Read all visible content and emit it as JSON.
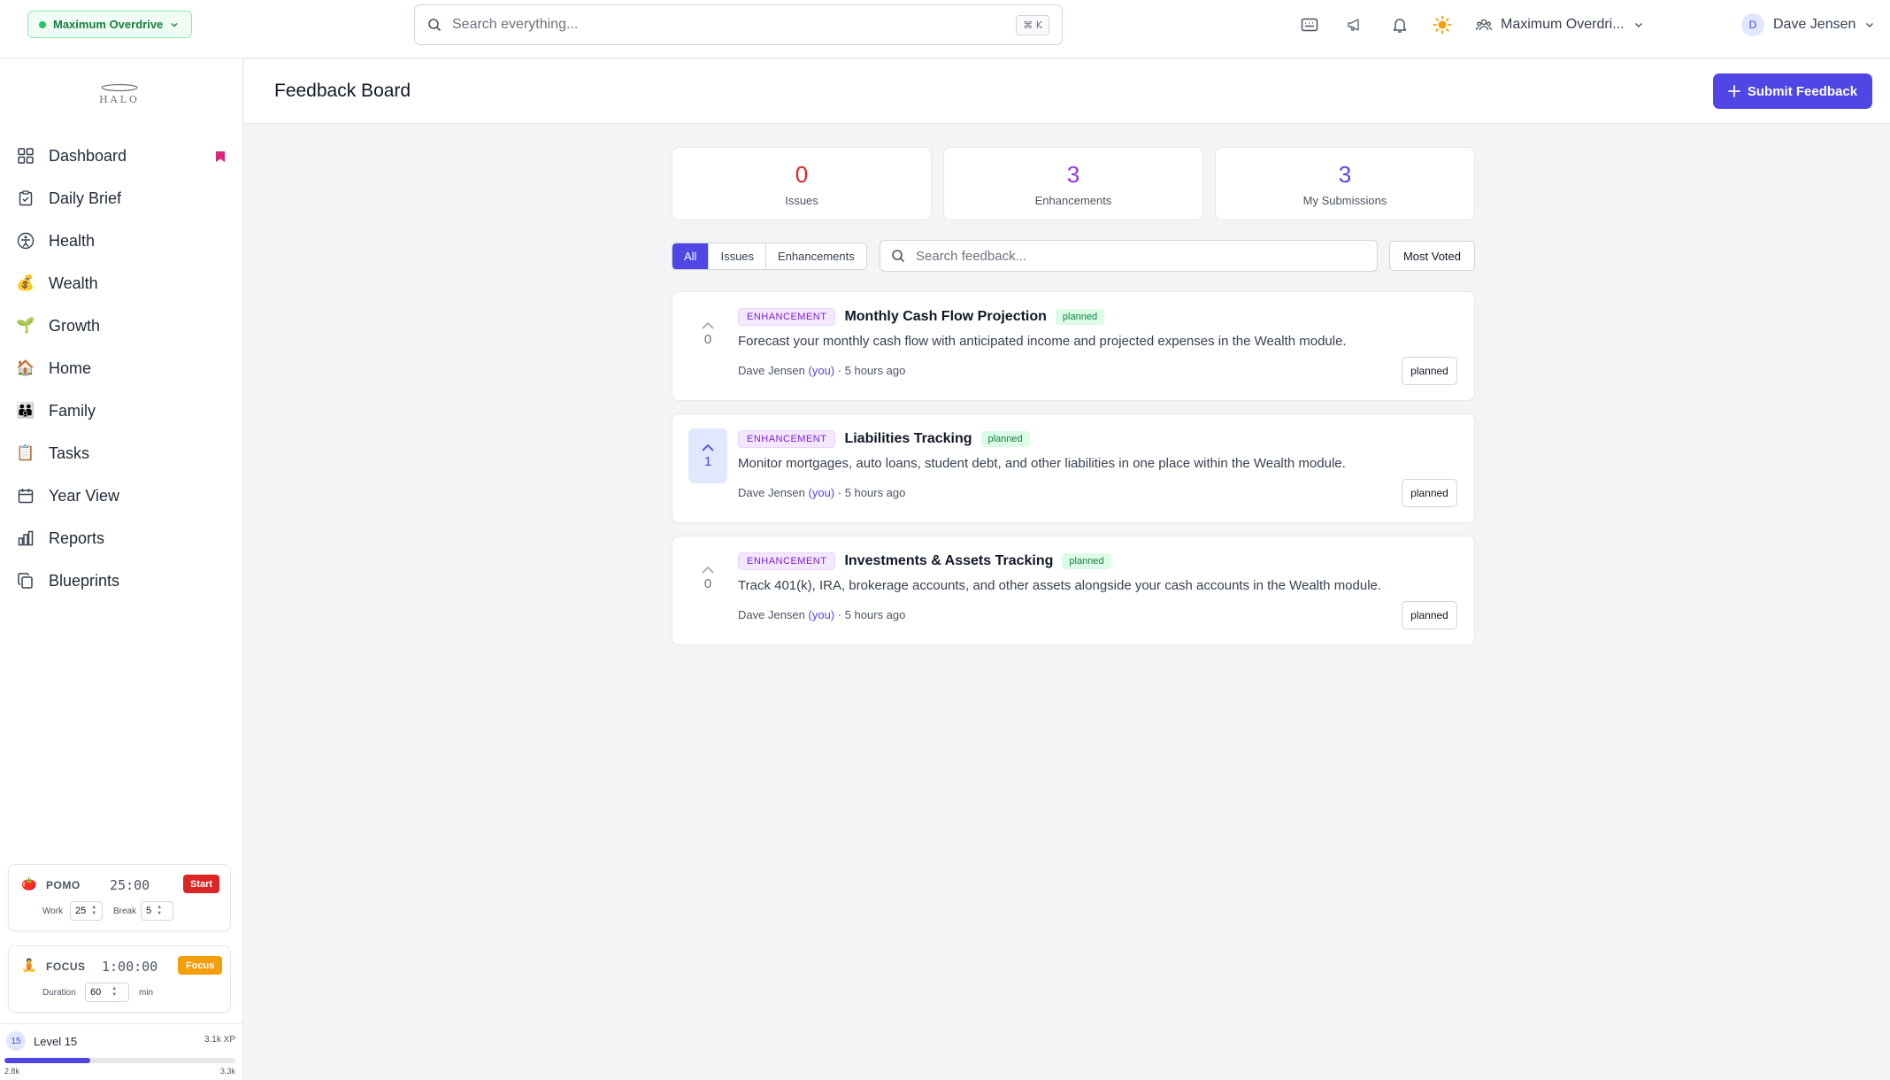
{
  "topbar": {
    "mode_label": "Maximum Overdrive",
    "search_placeholder": "Search everything...",
    "search_shortcut": "⌘ K",
    "workspace_label": "Maximum Overdri...",
    "user_initial": "D",
    "user_name": "Dave Jensen"
  },
  "sidebar": {
    "logo_text": "HALO",
    "items": [
      {
        "label": "Dashboard",
        "icon": "grid-icon"
      },
      {
        "label": "Daily Brief",
        "icon": "clipboard-check-icon"
      },
      {
        "label": "Health",
        "icon": "wellness-icon"
      },
      {
        "label": "Wealth",
        "icon": "money-bag-icon"
      },
      {
        "label": "Growth",
        "icon": "seedling-icon"
      },
      {
        "label": "Home",
        "icon": "house-icon"
      },
      {
        "label": "Family",
        "icon": "family-icon"
      },
      {
        "label": "Tasks",
        "icon": "notepad-icon"
      },
      {
        "label": "Year View",
        "icon": "calendar-icon"
      },
      {
        "label": "Reports",
        "icon": "bar-chart-icon"
      },
      {
        "label": "Blueprints",
        "icon": "copy-icon"
      }
    ],
    "pomo": {
      "title": "POMO",
      "timer": "25:00",
      "start_label": "Start",
      "work_label": "Work",
      "work_value": "25",
      "break_label": "Break",
      "break_value": "5"
    },
    "focus": {
      "title": "FOCUS",
      "timer": "1:00:00",
      "focus_label": "Focus",
      "duration_label": "Duration",
      "duration_value": "60",
      "unit": "min"
    },
    "level": {
      "badge": "15",
      "label": "Level 15",
      "xp": "3.1k XP",
      "min": "2.8k",
      "max": "3.3k",
      "progress": 0.37
    }
  },
  "header": {
    "title": "Feedback Board",
    "submit_label": "Submit Feedback"
  },
  "stats": [
    {
      "value": "0",
      "label": "Issues",
      "color": "#dc2626"
    },
    {
      "value": "3",
      "label": "Enhancements",
      "color": "#9333ea"
    },
    {
      "value": "3",
      "label": "My Submissions",
      "color": "#4f46e5"
    }
  ],
  "filters": {
    "tabs": [
      "All",
      "Issues",
      "Enhancements"
    ],
    "search_placeholder": "Search feedback...",
    "sort_label": "Most Voted"
  },
  "items": [
    {
      "votes": "0",
      "voted": false,
      "category": "ENHANCEMENT",
      "title": "Monthly Cash Flow Projection",
      "status": "planned",
      "description": "Forecast your monthly cash flow with anticipated income and projected expenses in the Wealth module.",
      "author": "Dave Jensen",
      "you": "(you)",
      "time": "· 5 hours ago",
      "status_select": "planned"
    },
    {
      "votes": "1",
      "voted": true,
      "category": "ENHANCEMENT",
      "title": "Liabilities Tracking",
      "status": "planned",
      "description": "Monitor mortgages, auto loans, student debt, and other liabilities in one place within the Wealth module.",
      "author": "Dave Jensen",
      "you": "(you)",
      "time": "· 5 hours ago",
      "status_select": "planned"
    },
    {
      "votes": "0",
      "voted": false,
      "category": "ENHANCEMENT",
      "title": "Investments & Assets Tracking",
      "status": "planned",
      "description": "Track 401(k), IRA, brokerage accounts, and other assets alongside your cash accounts in the Wealth module.",
      "author": "Dave Jensen",
      "you": "(you)",
      "time": "· 5 hours ago",
      "status_select": "planned"
    }
  ],
  "colors": {
    "accent": "#4f46e5",
    "bookmark": "#db2777"
  }
}
